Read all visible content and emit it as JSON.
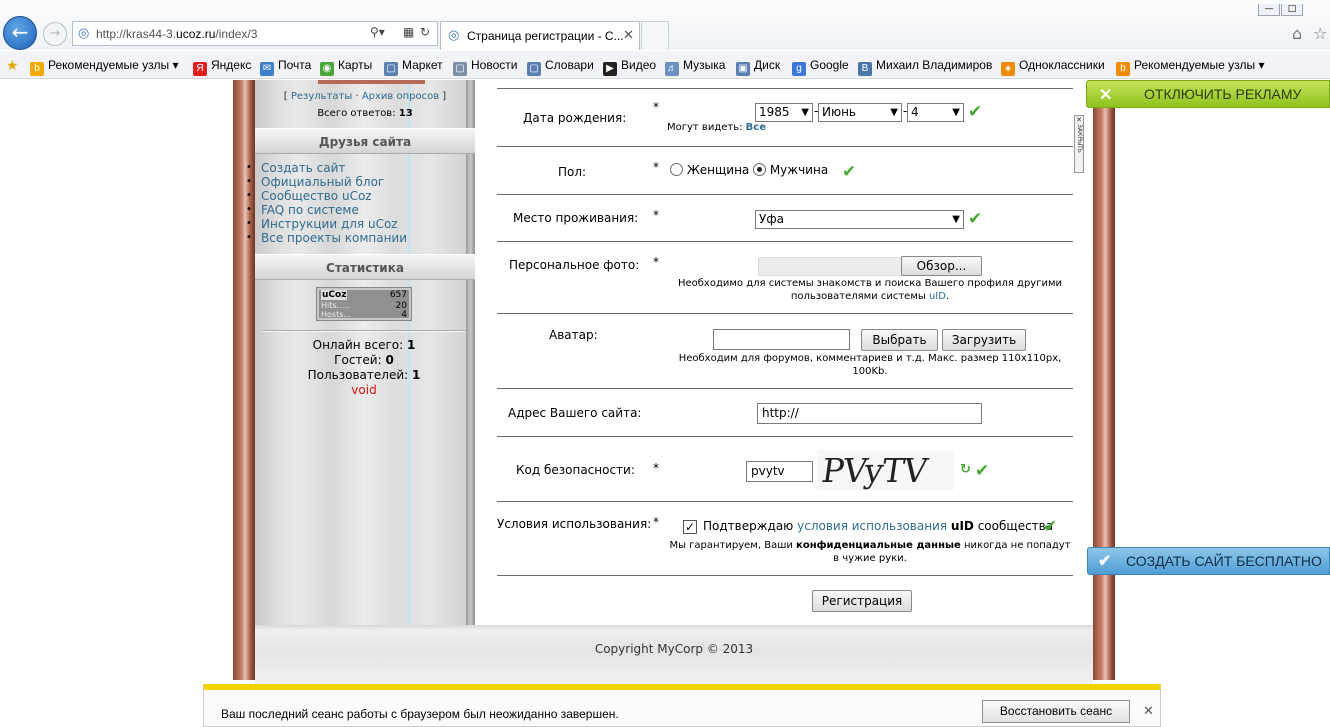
{
  "browser": {
    "url_prefix": "http://kras44-3.",
    "url_domain": "ucoz.ru",
    "url_path": "/index/3",
    "tab_title": "Страница регистрации - С...",
    "favorites": [
      {
        "label": "Рекомендуемые узлы ▾",
        "icon": "bing-icon",
        "color": "#f2a900"
      },
      {
        "label": "Яндекс",
        "icon": "yandex-icon",
        "color": "#e02020"
      },
      {
        "label": "Почта",
        "icon": "mail-icon",
        "color": "#3f7fd0"
      },
      {
        "label": "Карты",
        "icon": "maps-icon",
        "color": "#4aa63a"
      },
      {
        "label": "Маркет",
        "icon": "page-icon",
        "color": "#5a7fb0"
      },
      {
        "label": "Новости",
        "icon": "page-icon",
        "color": "#7a8ea8"
      },
      {
        "label": "Словари",
        "icon": "page-icon",
        "color": "#5a7fb0"
      },
      {
        "label": "Видео",
        "icon": "video-icon",
        "color": "#222"
      },
      {
        "label": "Музыка",
        "icon": "music-icon",
        "color": "#6a8fc0"
      },
      {
        "label": "Диск",
        "icon": "disk-icon",
        "color": "#5a7fb0"
      },
      {
        "label": "Google",
        "icon": "google-icon",
        "color": "#3b78d8"
      },
      {
        "label": "Михаил Владимиров",
        "icon": "vk-icon",
        "color": "#4a76a8"
      },
      {
        "label": "Одноклассники",
        "icon": "ok-icon",
        "color": "#f08a00"
      },
      {
        "label": "Рекомендуемые узлы ▾",
        "icon": "bing-icon",
        "color": "#f08a00"
      }
    ]
  },
  "sidebar": {
    "poll_results": "Результаты",
    "poll_archive": "Архив опросов",
    "total_answers_label": "Всего ответов:",
    "total_answers": "13",
    "friends_title": "Друзья сайта",
    "friends_links": [
      "Создать сайт",
      "Официальный блог",
      "Сообщество uCoz",
      "FAQ по системе",
      "Инструкции для uCoz",
      "Все проекты компании"
    ],
    "stats_title": "Статистика",
    "counter": {
      "brand": "uCoz",
      "total": "657",
      "hits_label": "Hits.....",
      "hits": "20",
      "hosts_label": "Hosts...",
      "hosts": "4"
    },
    "online_label": "Онлайн всего:",
    "online": "1",
    "guests_label": "Гостей:",
    "guests": "0",
    "users_label": "Пользователей:",
    "users": "1",
    "void": "void"
  },
  "form": {
    "birth_label": "Дата рождения:",
    "birth_year": "1985",
    "birth_month": "Июнь",
    "birth_day": "4",
    "visible_label": "Могут видеть:",
    "visible_value": "Все",
    "gender_label": "Пол:",
    "gender_female": "Женщина",
    "gender_male": "Мужчина",
    "residence_label": "Место проживания:",
    "residence_value": "Уфа",
    "photo_label": "Персональное фото:",
    "browse_button": "Обзор...",
    "photo_note_1": "Необходимо для системы знакомств и поиска Вашего профиля другими",
    "photo_note_2": "пользователями системы",
    "photo_note_link": "uID",
    "avatar_label": "Аватар:",
    "choose_button": "Выбрать",
    "upload_button": "Загрузить",
    "avatar_note_1": "Необходим для форумов, комментариев и т.д. Макс. размер 110x110px,",
    "avatar_note_2": "100Kb.",
    "site_label": "Адрес Вашего сайта:",
    "site_value": "http://",
    "captcha_label": "Код безопасности:",
    "captcha_value": "pvytv",
    "captcha_image_text": "PVyTV",
    "terms_label": "Условия использования:",
    "terms_confirm": "Подтверждаю",
    "terms_link": "условия использования",
    "terms_uid": "uID",
    "terms_community": "сообщества",
    "privacy_1": "Мы гарантируем, Ваши",
    "privacy_bold": "конфиденциальные данные",
    "privacy_2": "никогда не попадут",
    "privacy_3": "в чужие руки.",
    "asterisk": "*",
    "submit": "Регистрация"
  },
  "ads": {
    "disable_ads": "ОТКЛЮЧИТЬ РЕКЛАМУ",
    "create_site": "СОЗДАТЬ САЙТ БЕСПЛАТНО",
    "close_vertical": "ЗАКРЫТЬ"
  },
  "footer": {
    "copyright": "Copyright MyCorp © 2013"
  },
  "notification": {
    "message": "Ваш последний сеанс работы с браузером был неожиданно завершен.",
    "restore_button": "Восстановить сеанс"
  },
  "colors": {
    "link": "#2f6c8f",
    "check_green": "#44a832",
    "notify_yellow": "#f2d300"
  }
}
